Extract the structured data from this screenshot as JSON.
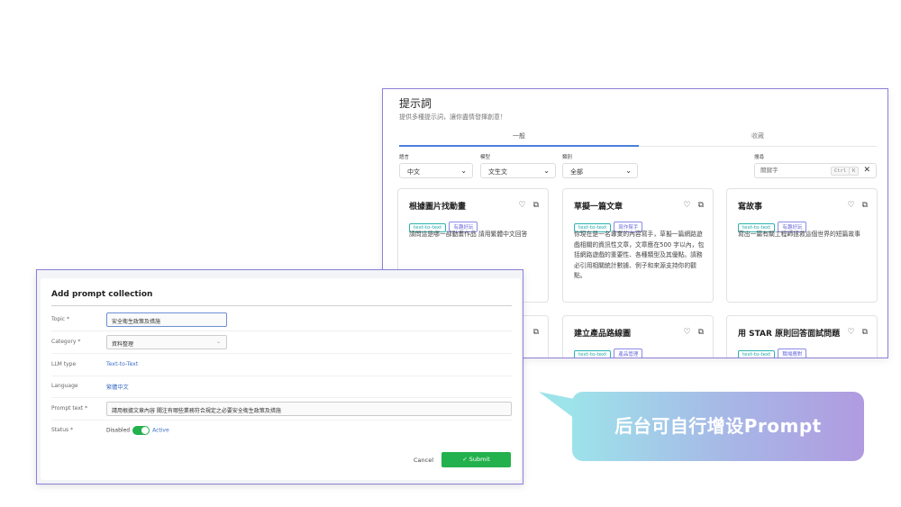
{
  "colors": {
    "accent_purple": "#8b7fd8",
    "tab_underline": "#4a7fd8",
    "submit_green": "#22b14c",
    "link_blue": "#3d6fc7",
    "tag_teal": "#2bb3b3",
    "tag_purple": "#8a8ae6",
    "callout_gradient": [
      "#9de3ea",
      "#a7b6e6",
      "#b09be0"
    ]
  },
  "library": {
    "title": "提示詞",
    "subtitle": "提供多種提示詞，讓你盡情發揮創意！",
    "tabs": [
      {
        "label": "一般",
        "active": true
      },
      {
        "label": "收藏",
        "active": false
      }
    ],
    "filters": {
      "language": {
        "label": "語言",
        "value": "中文"
      },
      "model": {
        "label": "模型",
        "value": "文生文"
      },
      "category": {
        "label": "類別",
        "value": "全部"
      },
      "search": {
        "label": "搜尋",
        "placeholder": "關鍵字",
        "shortcut_ctrl": "Ctrl",
        "shortcut_k": "K",
        "clear_icon": "close-icon"
      }
    },
    "cards": [
      {
        "title": "根據圖片找動畫",
        "tags": [
          "text-to-text",
          "有趣好玩"
        ],
        "desc": "請問這是哪一部動畫作品 請用繁體中文回答",
        "icons": [
          "heart-icon",
          "copy-icon"
        ]
      },
      {
        "title": "草擬一篇文章",
        "tags": [
          "text-to-text",
          "寫作幫手"
        ],
        "desc": "你現在是一名專業的內容寫手，草擬一篇網路遊戲相關的資訊性文章，文章應在500 字以內，包括網路遊戲的重要性、各種類型及其優點。請務必引用相關統計數據、例子和來源支持你的觀點。",
        "icons": [
          "heart-icon",
          "copy-icon"
        ]
      },
      {
        "title": "寫故事",
        "tags": [
          "text-to-text",
          "有趣好玩"
        ],
        "desc": "寫出一篇有關工程師拯救這個世界的短篇故事",
        "icons": [
          "heart-icon",
          "copy-icon"
        ]
      },
      {
        "title": "",
        "tags": [],
        "desc": "",
        "icons": [
          "copy-icon"
        ]
      },
      {
        "title": "建立產品路線圖",
        "tags": [
          "text-to-text",
          "產品管理"
        ],
        "desc": "",
        "icons": [
          "heart-icon",
          "copy-icon"
        ]
      },
      {
        "title": "用 STAR 原則回答面試問題",
        "tags": [
          "text-to-text",
          "職場應對"
        ],
        "desc": "",
        "icons": [
          "heart-icon",
          "copy-icon"
        ]
      }
    ]
  },
  "dialog": {
    "title": "Add prompt collection",
    "fields": {
      "topic": {
        "label": "Topic *",
        "value": "安全衛生政策及措施"
      },
      "category": {
        "label": "Category *",
        "value": "資料整理"
      },
      "llm_type": {
        "label": "LLM type",
        "value": "Text-to-Text"
      },
      "language": {
        "label": "Language",
        "value": "繁體中文"
      },
      "prompt_text": {
        "label": "Prompt text *",
        "value": "請用根據文章內容 關注有哪些業務符合規定之必要安全衛生政策及措施"
      },
      "status": {
        "label": "Status *",
        "off_label": "Disabled",
        "on_label": "Active",
        "enabled": true
      }
    },
    "cancel_label": "Cancel",
    "submit_label": "✓ Submit"
  },
  "callout": {
    "text": "后台可自行增设Prompt"
  }
}
